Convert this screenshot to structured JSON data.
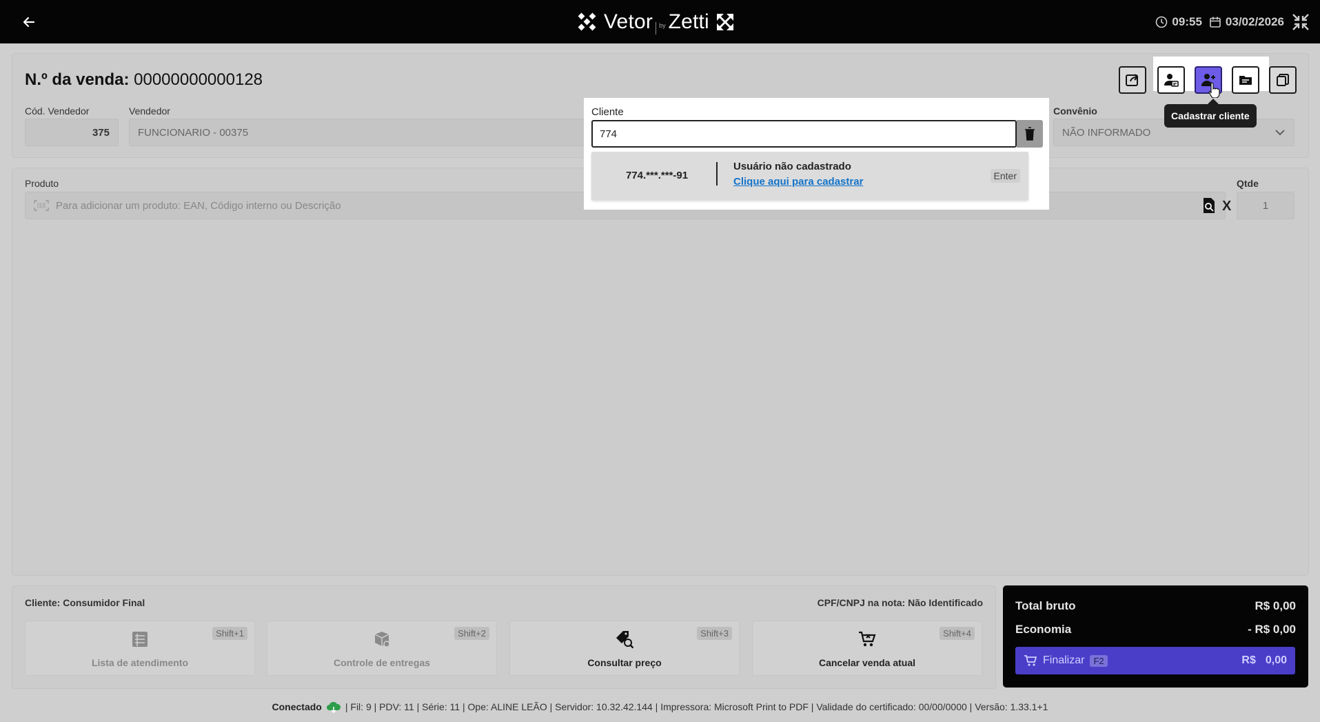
{
  "header": {
    "logo_left": "Vetor",
    "logo_by": "by",
    "logo_right": "Zetti",
    "time": "09:55",
    "date": "03/02/2026"
  },
  "sale": {
    "title_label": "N.º da venda:",
    "number": "00000000000128",
    "cod_vendedor_label": "Cód. Vendedor",
    "cod_vendedor_value": "375",
    "vendedor_label": "Vendedor",
    "vendedor_value": "FUNCIONARIO - 00375",
    "convenio_label": "Convênio",
    "convenio_value": "NÃO INFORMADO"
  },
  "tooltip": "Cadastrar cliente",
  "product": {
    "label": "Produto",
    "placeholder": "Para adicionar um produto: EAN, Código interno ou Descrição",
    "qty_label": "Qtde",
    "qty_value": "1",
    "multiply": "X"
  },
  "cliente": {
    "label": "Cliente",
    "value": "774",
    "suggestion_cpf": "774.***.***-91",
    "suggestion_title": "Usuário não cadastrado",
    "suggestion_link": "Clique aqui para cadastrar",
    "suggestion_key": "Enter"
  },
  "footer": {
    "client": "Cliente: Consumidor Final",
    "cpf": "CPF/CNPJ na nota: Não Identificado",
    "actions": [
      {
        "label": "Lista de atendimento",
        "shortcut": "Shift+1",
        "icon": "list-icon"
      },
      {
        "label": "Controle de entregas",
        "shortcut": "Shift+2",
        "icon": "delivery-box-icon"
      },
      {
        "label": "Consultar preço",
        "shortcut": "Shift+3",
        "icon": "price-search-icon"
      },
      {
        "label": "Cancelar venda atual",
        "shortcut": "Shift+4",
        "icon": "cart-cancel-icon"
      }
    ]
  },
  "totals": {
    "bruto_label": "Total bruto",
    "bruto_value": "R$ 0,00",
    "economia_label": "Economia",
    "economia_value": "- R$ 0,00",
    "finalizar_label": "Finalizar",
    "finalizar_key": "F2",
    "finalizar_currency": "R$",
    "finalizar_value": "0,00"
  },
  "status": {
    "connected": "Conectado",
    "details": "| Fil: 9 | PDV: 11 | Série: 11 | Ope: ALINE LEÃO | Servidor: 10.32.42.144 | Impressora: Microsoft Print to PDF | Validade do certificado: 00/00/0000 | Versão: 1.33.1+1"
  },
  "colors": {
    "accent": "#4a3ec9",
    "link": "#1273c9",
    "status_ok": "#2e9d4a"
  }
}
